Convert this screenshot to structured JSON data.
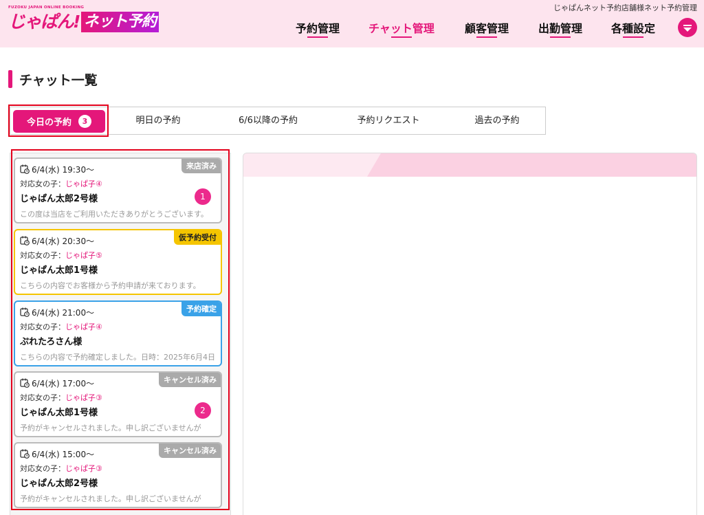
{
  "header": {
    "store_name": "じゃぱんネット予約店舗様ネット予約管理",
    "logo_tag": "FUZOKU JAPAN ONLINE BOOKING",
    "logo_main": "じゃぱん!",
    "logo_sub": "ネット予約",
    "nav": [
      {
        "label": "予約管理",
        "active": false
      },
      {
        "label": "チャット管理",
        "active": true
      },
      {
        "label": "顧客管理",
        "active": false
      },
      {
        "label": "出勤管理",
        "active": false
      },
      {
        "label": "各種設定",
        "active": false
      }
    ],
    "menu_icon": "menu-dropdown-icon"
  },
  "page_title": "チャット一覧",
  "tabs": {
    "active": {
      "label": "今日の予約",
      "badge": "3"
    },
    "others": [
      "明日の予約",
      "6/6以降の予約",
      "予約リクエスト",
      "過去の予約"
    ]
  },
  "colors": {
    "brand": "#e4177a",
    "visited": "#aaaaaa",
    "tentative": "#f5c500",
    "confirmed": "#3aa2e8",
    "cancelled": "#aaaaaa"
  },
  "chats": [
    {
      "datetime": "6/4(水) 19:30～",
      "girl_label": "対応女の子：",
      "girl": "じゃぱ子④",
      "name": "じゃぱん太郎2号様",
      "message": "この度は当店をご利用いただきありがとうございます。",
      "status": "来店済み",
      "status_color": "#aaaaaa",
      "unread": "1"
    },
    {
      "datetime": "6/4(水) 20:30～",
      "girl_label": "対応女の子：",
      "girl": "じゃぱ子⑤",
      "name": "じゃぱん太郎1号様",
      "message": "こちらの内容でお客様から予約申請が来ております。",
      "status": "仮予約受付",
      "status_color": "#f5c500",
      "unread": ""
    },
    {
      "datetime": "6/4(水) 21:00～",
      "girl_label": "対応女の子：",
      "girl": "じゃぱ子④",
      "name": "ぷれたろさん様",
      "message": "こちらの内容で予約確定しました。日時：2025年6月4日",
      "status": "予約確定",
      "status_color": "#3aa2e8",
      "unread": ""
    },
    {
      "datetime": "6/4(水) 17:00～",
      "girl_label": "対応女の子：",
      "girl": "じゃぱ子③",
      "name": "じゃぱん太郎1号様",
      "message": "予約がキャンセルされました。申し訳ございませんが",
      "status": "キャンセル済み",
      "status_color": "#aaaaaa",
      "unread": "2"
    },
    {
      "datetime": "6/4(水) 15:00～",
      "girl_label": "対応女の子：",
      "girl": "じゃぱ子③",
      "name": "じゃぱん太郎2号様",
      "message": "予約がキャンセルされました。申し訳ございませんが",
      "status": "キャンセル済み",
      "status_color": "#aaaaaa",
      "unread": ""
    }
  ]
}
